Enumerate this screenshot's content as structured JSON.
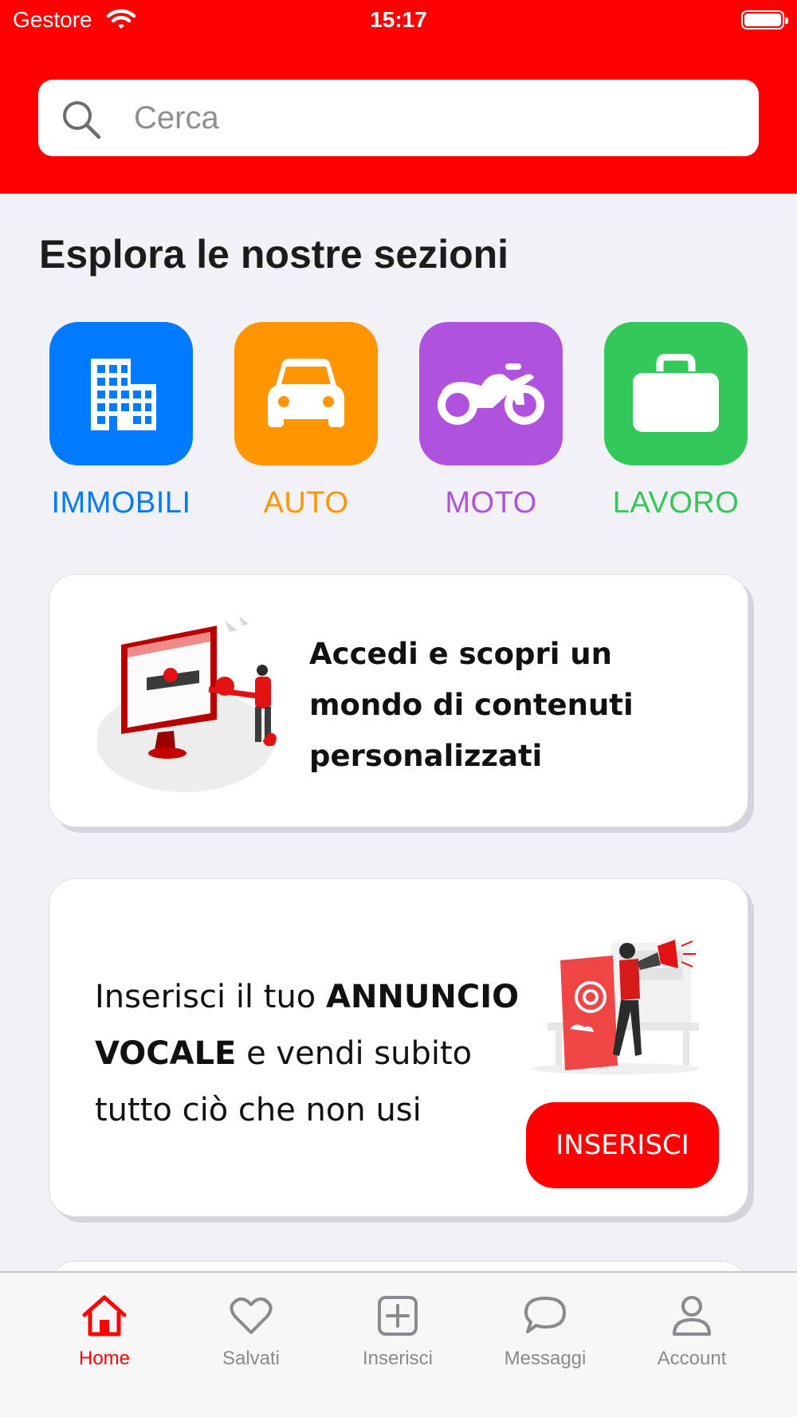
{
  "status_bar": {
    "carrier": "Gestore",
    "time": "15:17"
  },
  "search": {
    "placeholder": "Cerca"
  },
  "sections": {
    "title": "Esplora le nostre sezioni",
    "items": [
      {
        "label": "IMMOBILI",
        "icon": "building-icon",
        "color": "#007aff"
      },
      {
        "label": "AUTO",
        "icon": "car-icon",
        "color": "#ff9500"
      },
      {
        "label": "MOTO",
        "icon": "motorcycle-icon",
        "color": "#af52de"
      },
      {
        "label": "LAVORO",
        "icon": "briefcase-icon",
        "color": "#34c759"
      }
    ]
  },
  "login_card": {
    "text": "Accedi e scopri un mondo di contenuti personalizzati"
  },
  "ad_card": {
    "text_prefix": "Inserisci il tuo ",
    "text_bold": "ANNUNCIO VOCALE",
    "text_suffix": " e vendi subito tutto ciò che non usi",
    "button_label": "INSERISCI"
  },
  "tab_bar": {
    "items": [
      {
        "label": "Home",
        "icon": "home-icon",
        "active": true
      },
      {
        "label": "Salvati",
        "icon": "heart-icon",
        "active": false
      },
      {
        "label": "Inserisci",
        "icon": "plus-square-icon",
        "active": false
      },
      {
        "label": "Messaggi",
        "icon": "chat-bubble-icon",
        "active": false
      },
      {
        "label": "Account",
        "icon": "person-icon",
        "active": false
      }
    ]
  },
  "colors": {
    "brand_red": "#fe0000",
    "background": "#f2f1f6"
  }
}
